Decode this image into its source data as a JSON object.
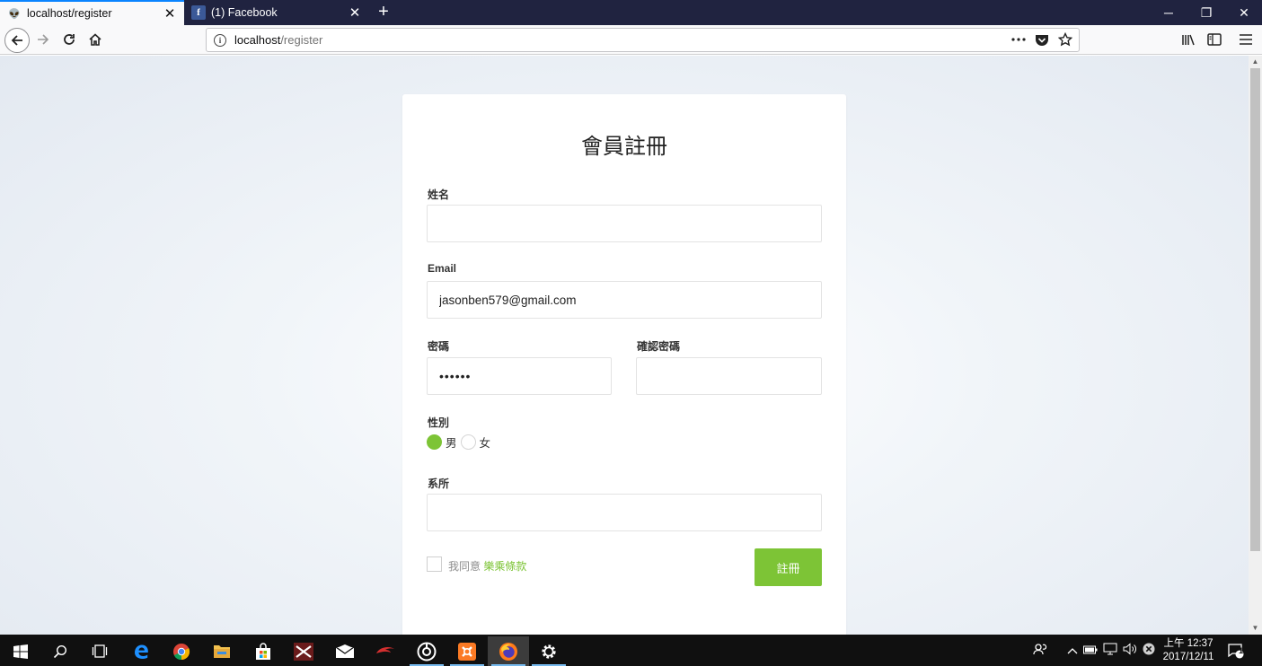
{
  "browser": {
    "tabs": [
      {
        "title": "localhost/register",
        "favicon": "alien-icon",
        "active": true
      },
      {
        "title": "(1) Facebook",
        "favicon": "facebook-icon",
        "active": false
      }
    ],
    "new_tab_label": "+",
    "url": {
      "host": "localhost",
      "path": "/register"
    },
    "window_controls": {
      "minimize": "─",
      "restore": "❐",
      "close": "✕"
    }
  },
  "form": {
    "title": "會員註冊",
    "name_label": "姓名",
    "name_value": "",
    "email_label": "Email",
    "email_value": "jasonben579@gmail.com",
    "password_label": "密碼",
    "password_value": "••••••",
    "confirm_label": "確認密碼",
    "confirm_value": "",
    "gender_label": "性別",
    "gender_options": [
      "男",
      "女"
    ],
    "gender_selected": "男",
    "dept_label": "系所",
    "dept_value": "",
    "agree_prefix": "我同意",
    "terms_link": "樂乘條款",
    "submit_label": "註冊"
  },
  "colors": {
    "accent": "#7dc436",
    "tab_strip": "#202340",
    "taskbar": "#101010"
  },
  "taskbar": {
    "clock_time": "上午 12:37",
    "clock_date": "2017/12/11",
    "notification_count": "1"
  }
}
